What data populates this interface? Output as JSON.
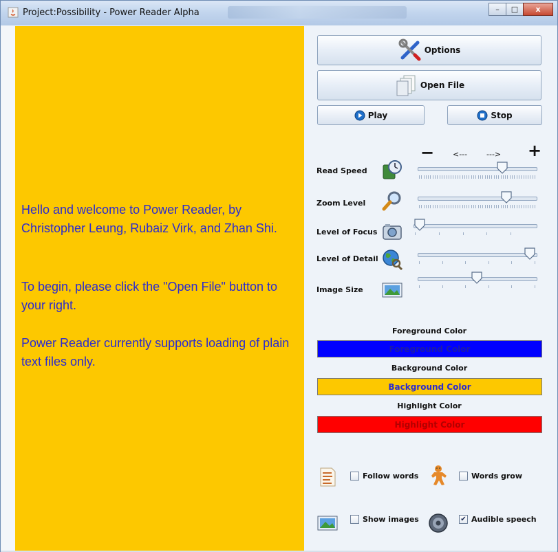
{
  "window": {
    "title": "Project:Possibility - Power Reader Alpha",
    "buttons": {
      "minimize": "–",
      "maximize": "□",
      "close": "x"
    }
  },
  "reader": {
    "paragraphs": [
      "Hello and welcome to Power Reader, by Christopher Leung, Rubaiz Virk, and Zhan Shi.",
      "To begin, please click the \"Open File\" button to your right.",
      "Power Reader currently supports loading of plain text files only."
    ],
    "background_color": "#FDC800",
    "text_color": "#2B2BD0"
  },
  "controls": {
    "options_label": "Options",
    "open_file_label": "Open File",
    "play_label": "Play",
    "stop_label": "Stop",
    "minus_label": "−",
    "left_arrow_label": "<---",
    "right_arrow_label": "--->",
    "plus_label": "+"
  },
  "sliders": {
    "read_speed": {
      "label": "Read Speed",
      "value": 0.74,
      "icon": "clock-book-icon"
    },
    "zoom_level": {
      "label": "Zoom Level",
      "value": 0.78,
      "icon": "magnifier-icon"
    },
    "level_of_focus": {
      "label": "Level of Focus",
      "value": 0.0,
      "icon": "camera-icon"
    },
    "level_of_detail": {
      "label": "Level of Detail",
      "value": 1.0,
      "icon": "globe-icon"
    },
    "image_size": {
      "label": "Image Size",
      "value": 0.5,
      "icon": "picture-icon"
    }
  },
  "colors": {
    "foreground": {
      "title": "Foreground Color",
      "button": "Foreground Color",
      "value": "#0000FF"
    },
    "background": {
      "title": "Background Color",
      "button": "Background Color",
      "value": "#FDC800"
    },
    "highlight": {
      "title": "Highlight Color",
      "button": "Highlight Color",
      "value": "#FF0000"
    }
  },
  "options": {
    "follow_words": {
      "label": "Follow words",
      "checked": false
    },
    "words_grow": {
      "label": "Words grow",
      "checked": false
    },
    "show_images": {
      "label": "Show images",
      "checked": false
    },
    "audible_speech": {
      "label": "Audible speech",
      "checked": true
    }
  }
}
